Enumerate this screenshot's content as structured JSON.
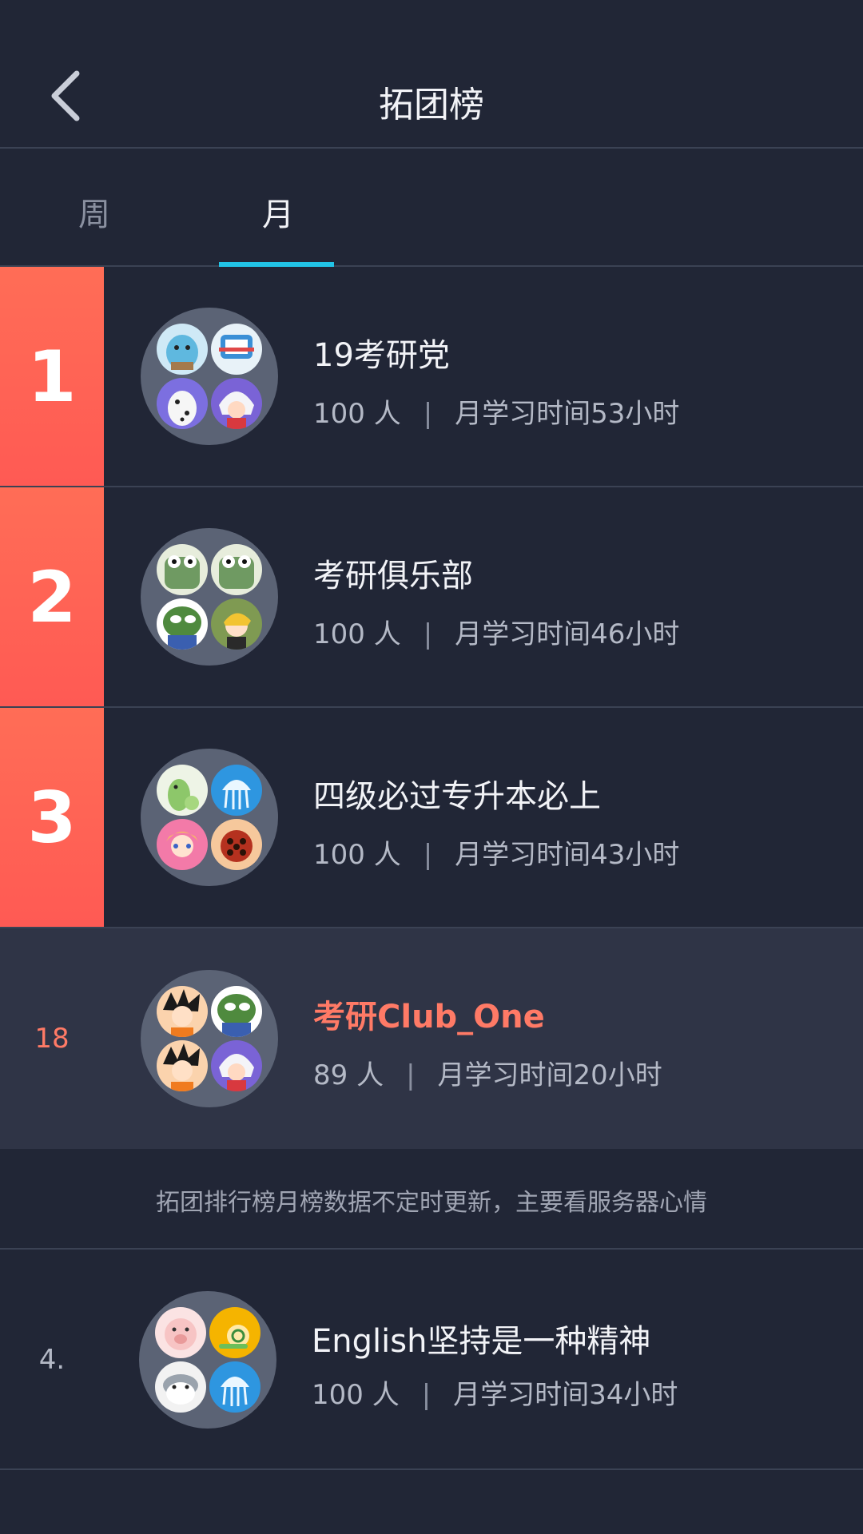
{
  "header": {
    "title": "拓团榜",
    "back_icon": "chevron-left-icon"
  },
  "tabs": [
    {
      "label": "周",
      "active": false
    },
    {
      "label": "月",
      "active": true
    }
  ],
  "colors": {
    "accent": "#22c3e6",
    "rank_badge": "#ff5f55",
    "highlight": "#ff7a66",
    "background": "#212636"
  },
  "rankings": [
    {
      "rank": "1",
      "name": "19考研党",
      "members": "100 人",
      "separator": "|",
      "time": "月学习时间53小时",
      "avatars": [
        "blue-monster-avatar",
        "robot-cat-avatar",
        "dalmatian-avatar",
        "white-haired-boy-avatar"
      ]
    },
    {
      "rank": "2",
      "name": "考研俱乐部",
      "members": "100 人",
      "separator": "|",
      "time": "月学习时间46小时",
      "avatars": [
        "green-frog-avatar",
        "green-frog-avatar",
        "pepe-frog-avatar",
        "blonde-boy-avatar"
      ]
    },
    {
      "rank": "3",
      "name": "四级必过专升本必上",
      "members": "100 人",
      "separator": "|",
      "time": "月学习时间43小时",
      "avatars": [
        "green-dinosaur-avatar",
        "jellyfish-avatar",
        "sailor-girl-avatar",
        "ladybug-avatar"
      ]
    }
  ],
  "my_group": {
    "rank": "18",
    "name": "考研Club_One",
    "members": "89 人",
    "separator": "|",
    "time": "月学习时间20小时",
    "avatars": [
      "goku-avatar",
      "pepe-frog-avatar",
      "goku-avatar",
      "white-haired-boy-avatar"
    ]
  },
  "notice": "拓团排行榜月榜数据不定时更新，主要看服务器心情",
  "other_rankings": [
    {
      "rank": "4.",
      "name": "English坚持是一种精神",
      "members": "100 人",
      "separator": "|",
      "time": "月学习时间34小时",
      "avatars": [
        "pink-pig-avatar",
        "snail-avatar",
        "hamster-avatar",
        "jellyfish-avatar"
      ]
    }
  ]
}
